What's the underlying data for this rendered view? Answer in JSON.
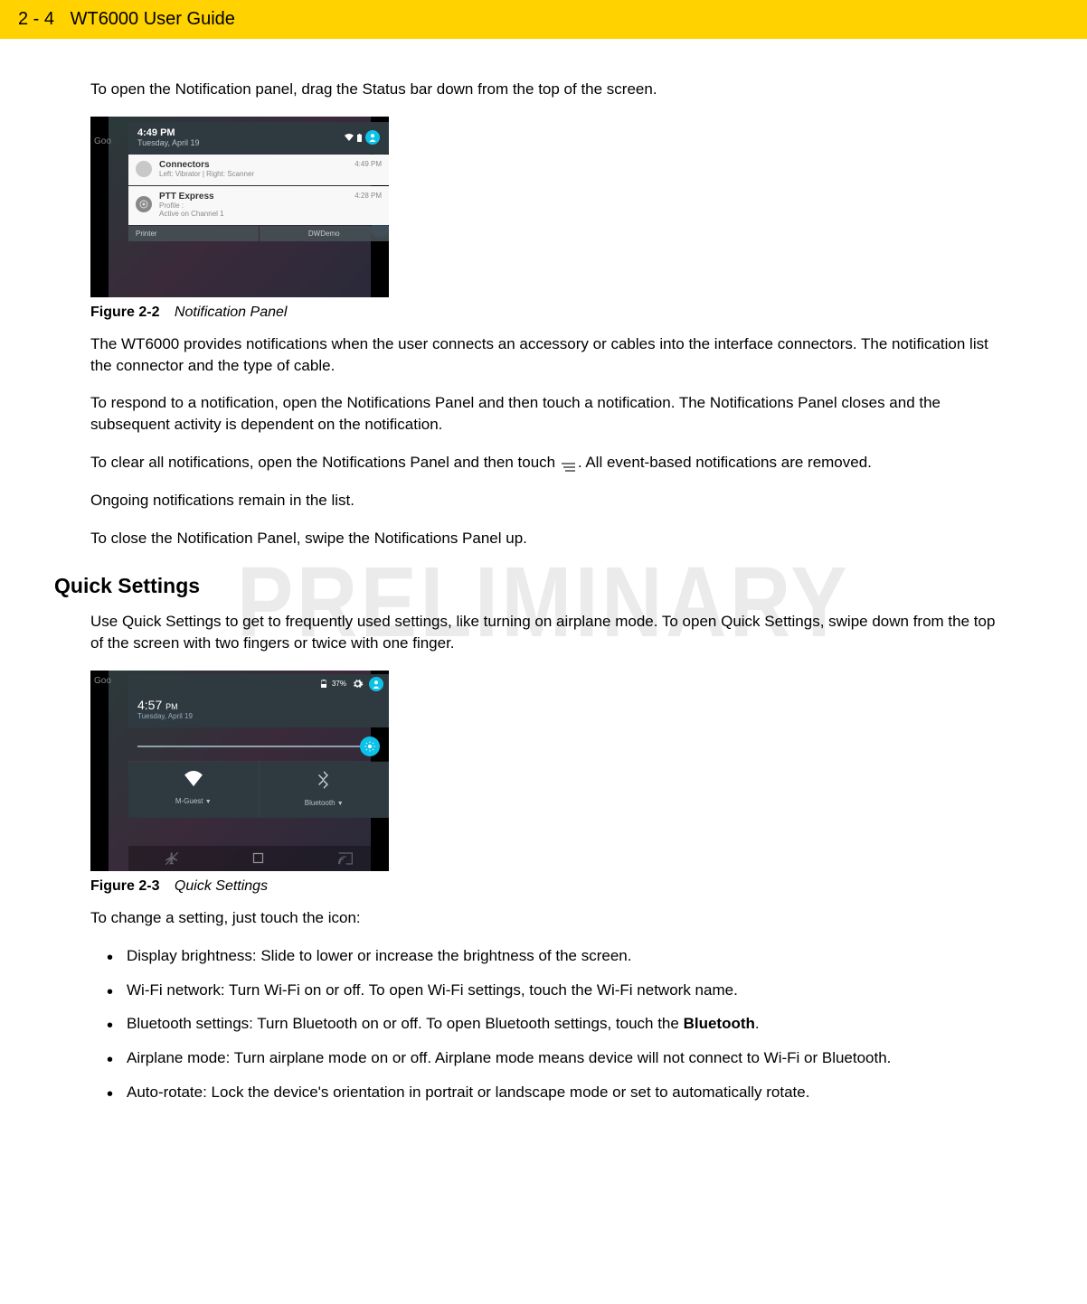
{
  "header": {
    "page_num": "2 - 4",
    "title": "WT6000 User Guide"
  },
  "watermark": "PRELIMINARY",
  "intro_paragraph": "To open the Notification panel, drag the Status bar down from the top of the screen.",
  "figure1": {
    "number": "Figure 2-2",
    "title": "Notification Panel",
    "header_time": "4:49 PM",
    "header_date": "Tuesday, April 19",
    "notif1_title": "Connectors",
    "notif1_sub": "Left: Vibrator | Right: Scanner",
    "notif1_time": "4:49 PM",
    "notif2_title": "PTT Express",
    "notif2_sub1": "Profile :",
    "notif2_sub2": "Active on Channel 1",
    "notif2_time": "4:28 PM",
    "bottom_left": "Printer",
    "bottom_right": "DWDemo",
    "left_edge_text": "Goo"
  },
  "paragraphs": {
    "p1": "The WT6000 provides notifications when the user connects an accessory or cables into the interface connectors. The notification list the connector and the type of cable.",
    "p2": "To respond to a notification, open the Notifications Panel and then touch a notification. The Notifications Panel closes and the subsequent activity is dependent on the notification.",
    "p3_a": "To clear all notifications, open the Notifications Panel and then touch ",
    "p3_b": ". All event-based notifications are removed.",
    "p4": "Ongoing notifications remain in the list.",
    "p5": "To close the Notification Panel, swipe the Notifications Panel up."
  },
  "section2_title": "Quick Settings",
  "section2_intro": "Use Quick Settings to get to frequently used settings, like turning on airplane mode. To open Quick Settings, swipe down from the top of the screen with two fingers or twice with one finger.",
  "figure2": {
    "number": "Figure 2-3",
    "title": "Quick Settings",
    "battery_text": "37%",
    "time": "4:57",
    "pm": "PM",
    "date": "Tuesday, April 19",
    "tile1_label": "M-Guest",
    "tile2_label": "Bluetooth",
    "left_edge_text": "Goo"
  },
  "change_intro": "To change a setting, just touch the icon:",
  "bullets": {
    "b1": "Display brightness: Slide to lower or increase the brightness of the screen.",
    "b2": "Wi-Fi network: Turn Wi-Fi on or off. To open Wi-Fi settings, touch the Wi-Fi network name.",
    "b3_a": "Bluetooth settings: Turn Bluetooth on or off. To open Bluetooth settings, touch the ",
    "b3_b": "Bluetooth",
    "b3_c": ".",
    "b4": "Airplane mode: Turn airplane mode on or off. Airplane mode means device will not connect to Wi-Fi or Bluetooth.",
    "b5": "Auto-rotate: Lock the device's orientation in portrait or landscape mode or set to automatically rotate."
  }
}
